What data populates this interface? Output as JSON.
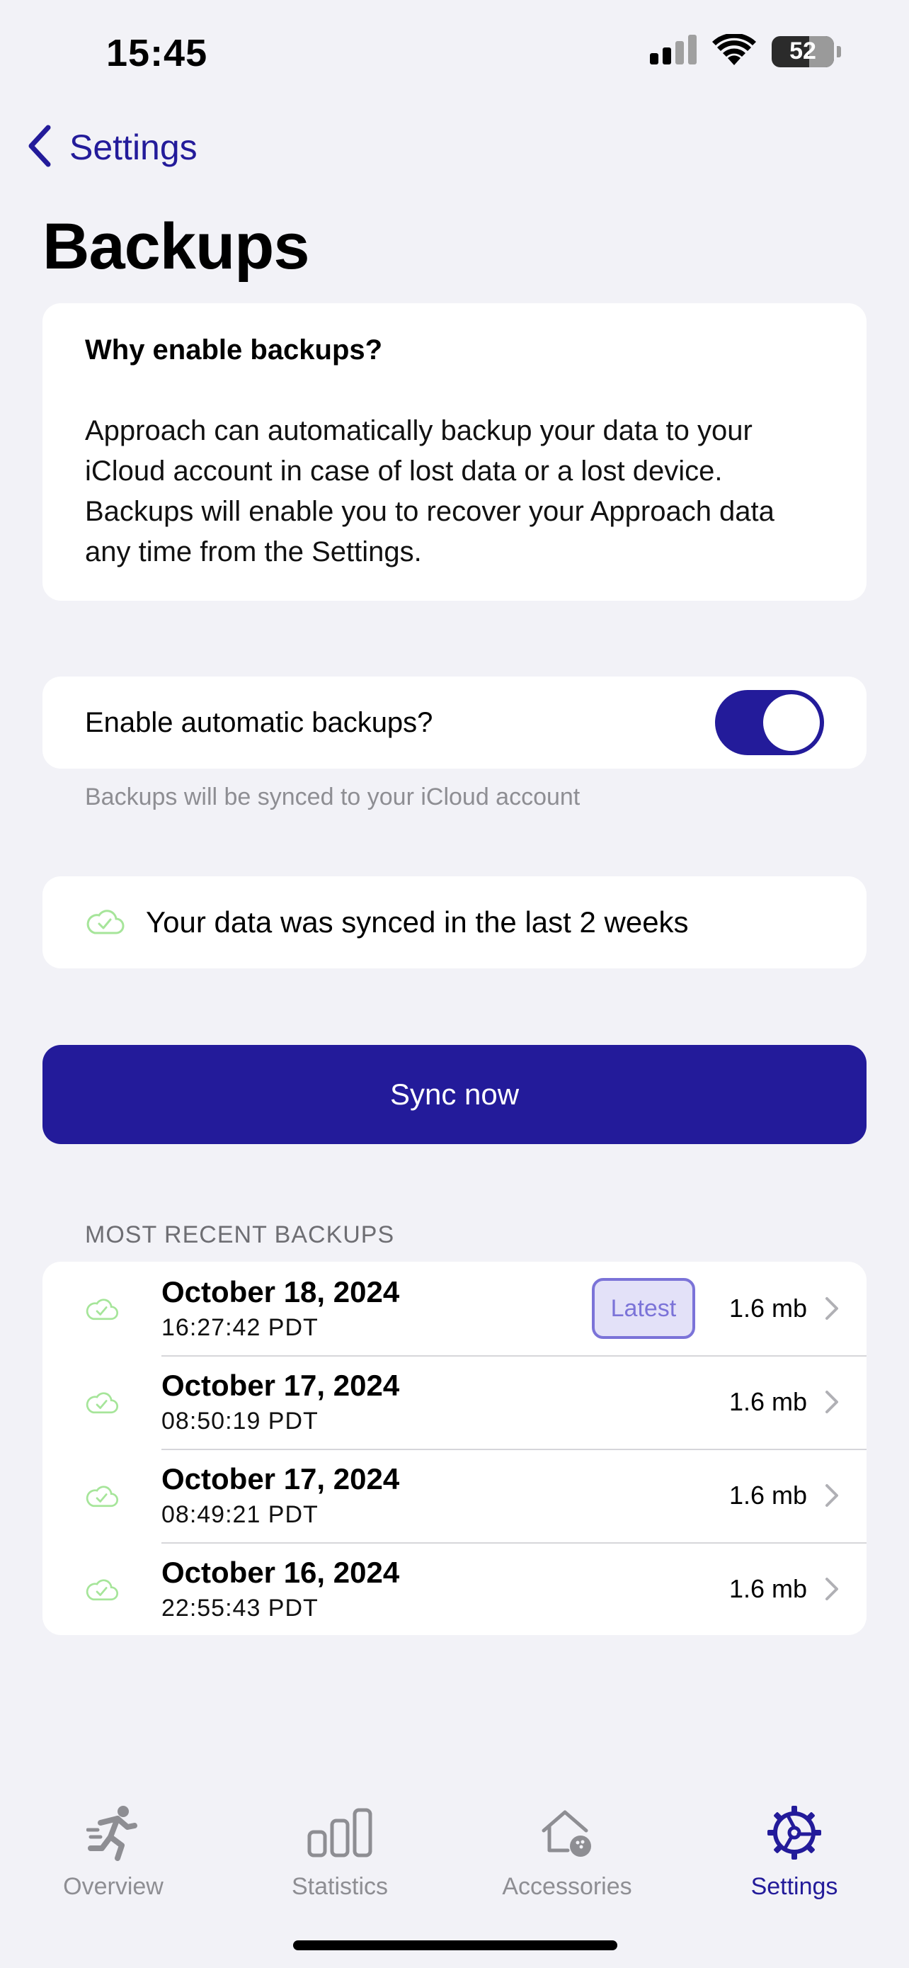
{
  "status_bar": {
    "time": "15:45",
    "battery": "52",
    "icons": [
      "signal-icon",
      "wifi-icon",
      "battery-icon"
    ]
  },
  "nav": {
    "back_label": "Settings",
    "back_icon": "chevron-left-icon"
  },
  "page": {
    "title": "Backups"
  },
  "info_card": {
    "title": "Why enable backups?",
    "body": "Approach can automatically backup your data to your iCloud account in case of lost data or a lost device. Backups will enable you to recover your Approach data any time from the Settings."
  },
  "auto_backup": {
    "label": "Enable automatic backups?",
    "enabled": true,
    "footnote": "Backups will be synced to your iCloud account"
  },
  "sync_status": {
    "icon": "cloud-check-icon",
    "text": "Your data was synced in the last 2 weeks"
  },
  "sync_button": {
    "label": "Sync now"
  },
  "recent_backups": {
    "header": "MOST RECENT BACKUPS",
    "latest_label": "Latest",
    "items": [
      {
        "date": "October 18, 2024",
        "time": "16:27:42 PDT",
        "size": "1.6 mb",
        "latest": true
      },
      {
        "date": "October 17, 2024",
        "time": "08:50:19 PDT",
        "size": "1.6 mb",
        "latest": false
      },
      {
        "date": "October 17, 2024",
        "time": "08:49:21 PDT",
        "size": "1.6 mb",
        "latest": false
      },
      {
        "date": "October 16, 2024",
        "time": "22:55:43 PDT",
        "size": "1.6 mb",
        "latest": false
      }
    ]
  },
  "tab_bar": {
    "tabs": [
      {
        "label": "Overview",
        "icon": "runner-icon",
        "active": false
      },
      {
        "label": "Statistics",
        "icon": "bar-chart-icon",
        "active": false
      },
      {
        "label": "Accessories",
        "icon": "house-ball-icon",
        "active": false
      },
      {
        "label": "Settings",
        "icon": "gear-icon",
        "active": true
      }
    ]
  },
  "colors": {
    "accent": "#231b9a",
    "background": "#f2f2f7",
    "success_green": "#a6e59a",
    "secondary_text": "#8e8e93",
    "badge_border": "#7b73d8",
    "badge_fill": "#e3e1f8"
  }
}
